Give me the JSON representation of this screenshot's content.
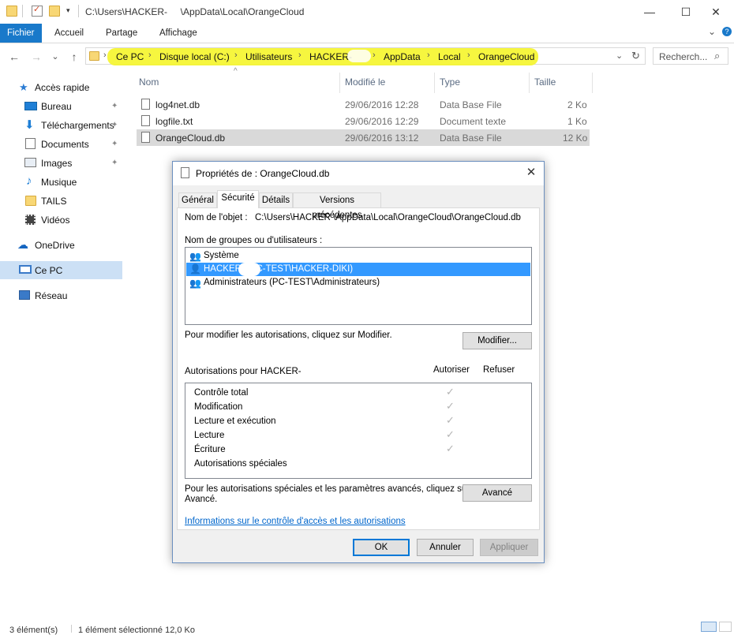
{
  "window": {
    "title": "C:\\Users\\HACKER-     \\AppData\\Local\\OrangeCloud",
    "minimize": "—",
    "maximize": "☐",
    "close": "✕"
  },
  "ribbon": {
    "tabs": [
      "Fichier",
      "Accueil",
      "Partage",
      "Affichage"
    ],
    "collapse": "⌄",
    "help": "?"
  },
  "nav": {
    "back": "←",
    "forward": "→",
    "recent": "⌄",
    "up": "↑",
    "breadcrumb": [
      "Ce PC",
      "Disque local (C:)",
      "Utilisateurs",
      "HACKER-",
      "AppData",
      "Local",
      "OrangeCloud"
    ],
    "dropdown": "⌄",
    "refresh": "↻"
  },
  "search": {
    "placeholder": "Recherch...",
    "icon": "search-icon"
  },
  "sidebar": {
    "items": [
      {
        "label": "Accès rapide",
        "icon": "star-icon"
      },
      {
        "label": "Bureau",
        "icon": "desktop-icon",
        "pinned": true
      },
      {
        "label": "Téléchargements",
        "icon": "download-icon",
        "pinned": true
      },
      {
        "label": "Documents",
        "icon": "documents-icon",
        "pinned": true
      },
      {
        "label": "Images",
        "icon": "images-icon",
        "pinned": true
      },
      {
        "label": "Musique",
        "icon": "music-icon"
      },
      {
        "label": "TAILS",
        "icon": "folder-icon"
      },
      {
        "label": "Vidéos",
        "icon": "video-icon"
      },
      {
        "label": "OneDrive",
        "icon": "cloud-icon"
      },
      {
        "label": "Ce PC",
        "icon": "computer-icon",
        "selected": true
      },
      {
        "label": "Réseau",
        "icon": "network-icon"
      }
    ],
    "pin_glyph": "📌"
  },
  "filelist": {
    "columns": [
      "Nom",
      "Modifié le",
      "Type",
      "Taille"
    ],
    "sort_indicator": "^",
    "rows": [
      {
        "name": "log4net.db",
        "modified": "29/06/2016 12:28",
        "type": "Data Base File",
        "size": "2 Ko"
      },
      {
        "name": "logfile.txt",
        "modified": "29/06/2016 12:29",
        "type": "Document texte",
        "size": "1 Ko"
      },
      {
        "name": "OrangeCloud.db",
        "modified": "29/06/2016 13:12",
        "type": "Data Base File",
        "size": "12 Ko",
        "selected": true
      }
    ]
  },
  "status": {
    "count": "3 élément(s)",
    "selection": "1 élément sélectionné  12,0 Ko"
  },
  "dialog": {
    "title": "Propriétés de : OrangeCloud.db",
    "close": "✕",
    "tabs": [
      "Général",
      "Sécurité",
      "Détails",
      "Versions précédentes"
    ],
    "active_tab": "Sécurité",
    "object_label": "Nom de l'objet :",
    "object_value": "C:\\Users\\HACKER        \\AppData\\Local\\OrangeCloud\\OrangeCloud.db",
    "groups_label": "Nom de groupes ou d'utilisateurs :",
    "users": [
      {
        "label": "Système",
        "icon": "users-icon"
      },
      {
        "label": "HACKER-        (PC-TEST\\HACKER-DIKI)",
        "icon": "user-icon",
        "selected": true
      },
      {
        "label": "Administrateurs (PC-TEST\\Administrateurs)",
        "icon": "users-icon"
      }
    ],
    "modify_hint": "Pour modifier les autorisations, cliquez sur Modifier.",
    "modify_button": "Modifier...",
    "perms_for": "Autorisations pour HACKER-",
    "allow_header": "Autoriser",
    "deny_header": "Refuser",
    "permissions": [
      {
        "label": "Contrôle total",
        "allow": true
      },
      {
        "label": "Modification",
        "allow": true
      },
      {
        "label": "Lecture et exécution",
        "allow": true
      },
      {
        "label": "Lecture",
        "allow": true
      },
      {
        "label": "Écriture",
        "allow": true
      },
      {
        "label": "Autorisations spéciales",
        "allow": false
      }
    ],
    "check_glyph": "✓",
    "advanced_hint_1": "Pour les autorisations spéciales et les paramètres avancés, cliquez sur",
    "advanced_hint_2": "Avancé.",
    "advanced_button": "Avancé",
    "link": "Informations sur le contrôle d'accès et les autorisations",
    "ok": "OK",
    "cancel": "Annuler",
    "apply": "Appliquer"
  }
}
